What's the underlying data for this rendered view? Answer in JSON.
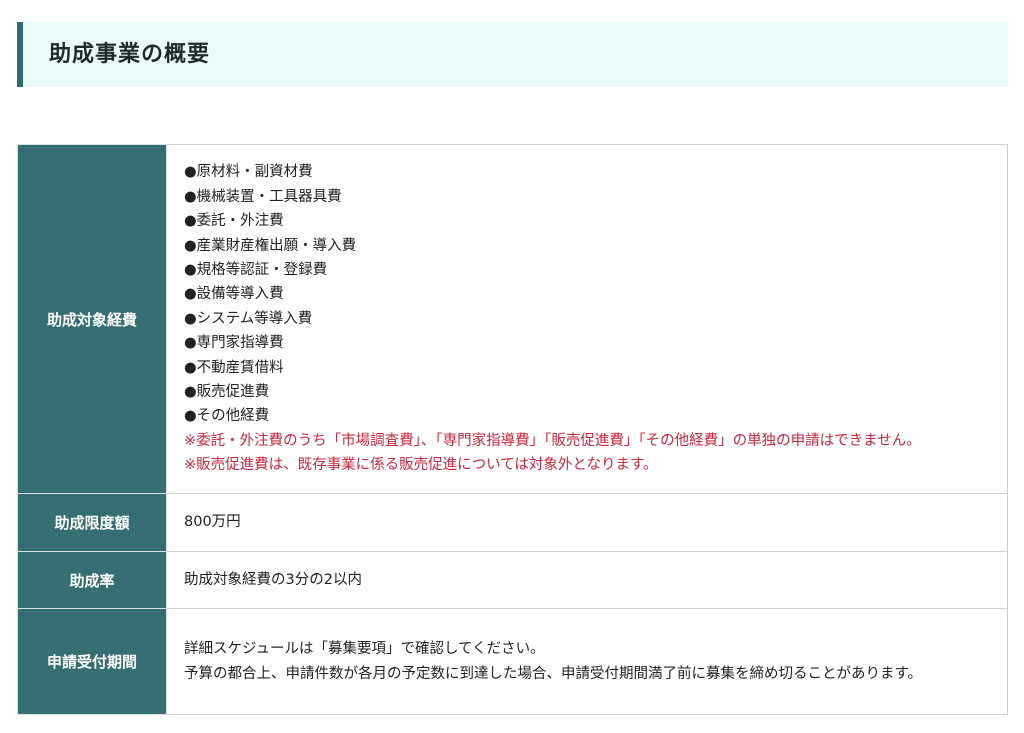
{
  "section": {
    "title": "助成事業の概要"
  },
  "table": {
    "rows": [
      {
        "label": "助成対象経費",
        "items": [
          "●原材料・副資材費",
          "●機械装置・工具器具費",
          "●委託・外注費",
          "●産業財産権出願・導入費",
          "●規格等認証・登録費",
          "●設備等導入費",
          "●システム等導入費",
          "●専門家指導費",
          "●不動産賃借料",
          "●販売促進費",
          "●その他経費"
        ],
        "notes": [
          "※委託・外注費のうち「市場調査費」、「専門家指導費」「販売促進費」「その他経費」の単独の申請はできません。",
          "※販売促進費は、既存事業に係る販売促進については対象外となります。"
        ]
      },
      {
        "label": "助成限度額",
        "value": "800万円"
      },
      {
        "label": "助成率",
        "value": "助成対象経費の3分の2以内"
      },
      {
        "label": "申請受付期間",
        "lines": [
          "詳細スケジュールは「募集要項」で確認してください。",
          "予算の都合上、申請件数が各月の予定数に到達した場合、申請受付期間満了前に募集を締め切ることがあります。"
        ]
      }
    ]
  },
  "colors": {
    "heading_bg": "#eafcf9",
    "heading_accent": "#2f6b70",
    "label_bg": "#356e73",
    "note_text": "#c8283e"
  }
}
